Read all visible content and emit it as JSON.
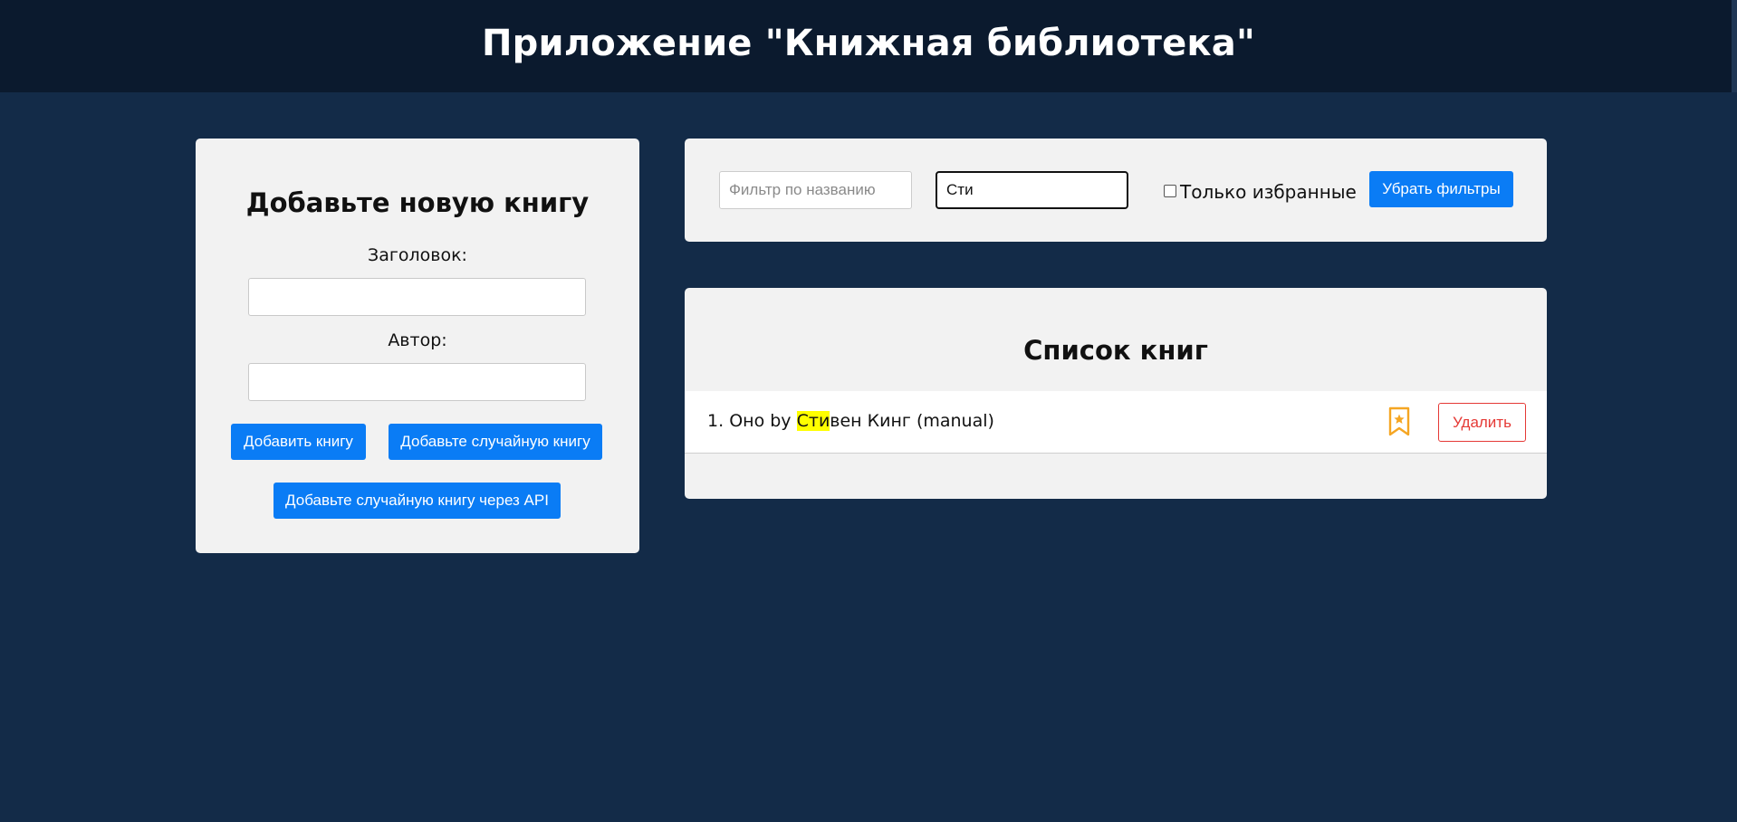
{
  "header": {
    "title": "Приложение \"Книжная библиотека\""
  },
  "add_form": {
    "heading": "Добавьте новую книгу",
    "title_label": "Заголовок:",
    "title_value": "",
    "author_label": "Автор:",
    "author_value": "",
    "add_button": "Добавить книгу",
    "random_button": "Добавьте случайную книгу",
    "api_button": "Добавьте случайную книгу через API"
  },
  "filters": {
    "title_placeholder": "Фильтр по названию",
    "title_value": "",
    "author_value": "Сти",
    "favorites_label": "Только избранные",
    "favorites_checked": false,
    "reset_button": "Убрать фильтры"
  },
  "book_list": {
    "heading": "Список книг",
    "items": [
      {
        "index": "1.",
        "title": "Оно",
        "by": "by",
        "author_highlight": "Сти",
        "author_rest": "вен Кинг",
        "source": "(manual)",
        "favorite_icon": "bookmark-star-icon",
        "delete_label": "Удалить"
      }
    ]
  },
  "colors": {
    "background": "#132b48",
    "header_bg": "#0b1a2e",
    "primary": "#0a7cf5",
    "danger": "#e53935",
    "favorite": "#f5a623",
    "highlight": "#ffff00"
  }
}
